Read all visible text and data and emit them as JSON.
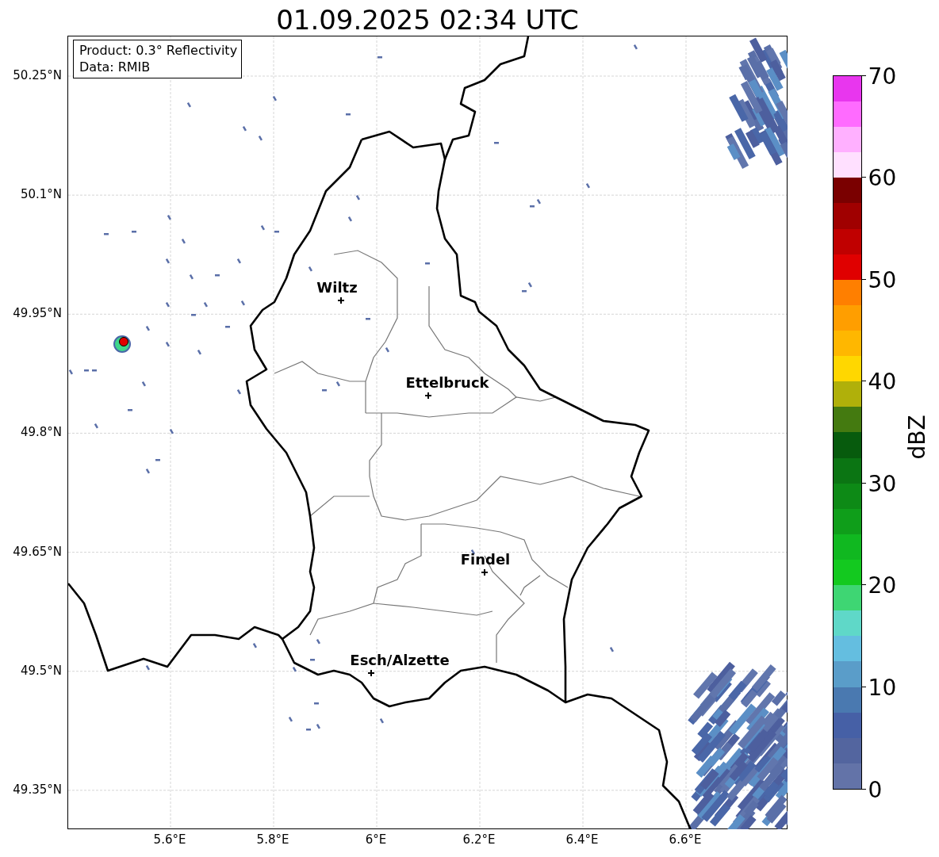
{
  "title": "01.09.2025 02:34 UTC",
  "legend": {
    "lines": [
      "Product: 0.3° Reflectivity",
      "Data: RMIB"
    ]
  },
  "map": {
    "cities": [
      "Wiltz",
      "Ettelbruck",
      "Findel",
      "Esch/Alzette"
    ],
    "y_ticks": [
      "50.25°N",
      "50.1°N",
      "49.95°N",
      "49.8°N",
      "49.65°N",
      "49.5°N",
      "49.35°N"
    ],
    "x_ticks": [
      "5.6°E",
      "5.8°E",
      "6°E",
      "6.2°E",
      "6.4°E",
      "6.6°E"
    ]
  },
  "colorbar": {
    "label": "dBZ",
    "ticks": [
      "70",
      "60",
      "50",
      "40",
      "30",
      "20",
      "10",
      "0"
    ],
    "segments": [
      {
        "color": "#6373a8"
      },
      {
        "color": "#53659f"
      },
      {
        "color": "#4660a6"
      },
      {
        "color": "#4a79b0"
      },
      {
        "color": "#5a9dc9"
      },
      {
        "color": "#64bee0"
      },
      {
        "color": "#5fd8c8"
      },
      {
        "color": "#3ed673"
      },
      {
        "color": "#13c91f"
      },
      {
        "color": "#10b820"
      },
      {
        "color": "#0f9e1a"
      },
      {
        "color": "#0d8a16"
      },
      {
        "color": "#0b7513"
      },
      {
        "color": "#075b0d"
      },
      {
        "color": "#447a10"
      },
      {
        "color": "#b0b00a"
      },
      {
        "color": "#ffd700"
      },
      {
        "color": "#ffb700"
      },
      {
        "color": "#ff9e00"
      },
      {
        "color": "#ff7f00"
      },
      {
        "color": "#e00000"
      },
      {
        "color": "#c00000"
      },
      {
        "color": "#a00000"
      },
      {
        "color": "#7a0000"
      },
      {
        "color": "#ffe0ff"
      },
      {
        "color": "#ffb0ff"
      },
      {
        "color": "#ff6bff"
      },
      {
        "color": "#e836ee"
      }
    ]
  }
}
